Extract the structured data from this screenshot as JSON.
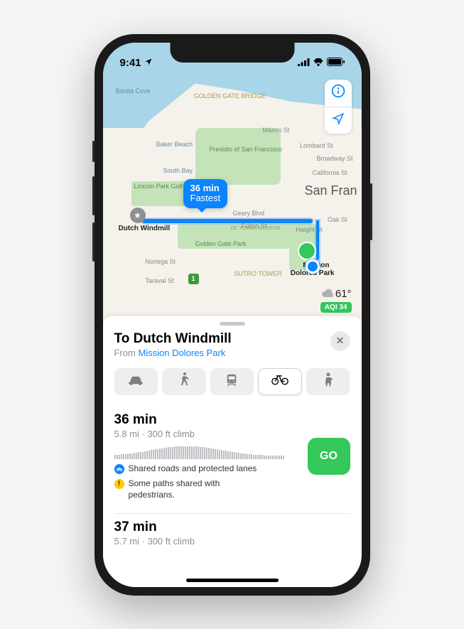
{
  "status": {
    "time": "9:41"
  },
  "map": {
    "labels": {
      "bonita_cove": "Bonita Cove",
      "golden_gate_bridge": "GOLDEN GATE BRIDGE",
      "baker_beach": "Baker Beach",
      "south_bay": "South Bay",
      "presidio": "Presidio of San Francisco",
      "lincoln": "Lincoln Park Golf Course",
      "city": "San Fran",
      "mason": "Mason St",
      "lombard": "Lombard St",
      "broadway": "Broadway St",
      "california": "California St",
      "fulton": "Fulton St",
      "geary": "Geary Blvd",
      "haight": "Haight St",
      "oak": "Oak St",
      "noriega": "Noriega St",
      "taraval": "Taraval St",
      "sutro": "SUTRO TOWER",
      "gg_park": "Golden Gate Park",
      "deyoung": "DE YOUNG MUSEUM",
      "route_hwy": "1"
    },
    "callout": {
      "line1": "36 min",
      "line2": "Fastest"
    },
    "origin_pin": "Dutch Windmill",
    "dest_pin_l1": "Mission",
    "dest_pin_l2": "Dolores Park",
    "weather": {
      "temp": "61°",
      "aqi": "AQI 34"
    }
  },
  "sheet": {
    "title": "To Dutch Windmill",
    "from_prefix": "From ",
    "from_link": "Mission Dolores Park",
    "routes": [
      {
        "time": "36 min",
        "meta": "5.8 mi · 300 ft climb",
        "go": "GO",
        "adv1": "Shared roads and protected lanes",
        "adv2": "Some paths shared with pedestrians."
      },
      {
        "time": "37 min",
        "meta": "5.7 mi · 300 ft climb"
      }
    ]
  }
}
